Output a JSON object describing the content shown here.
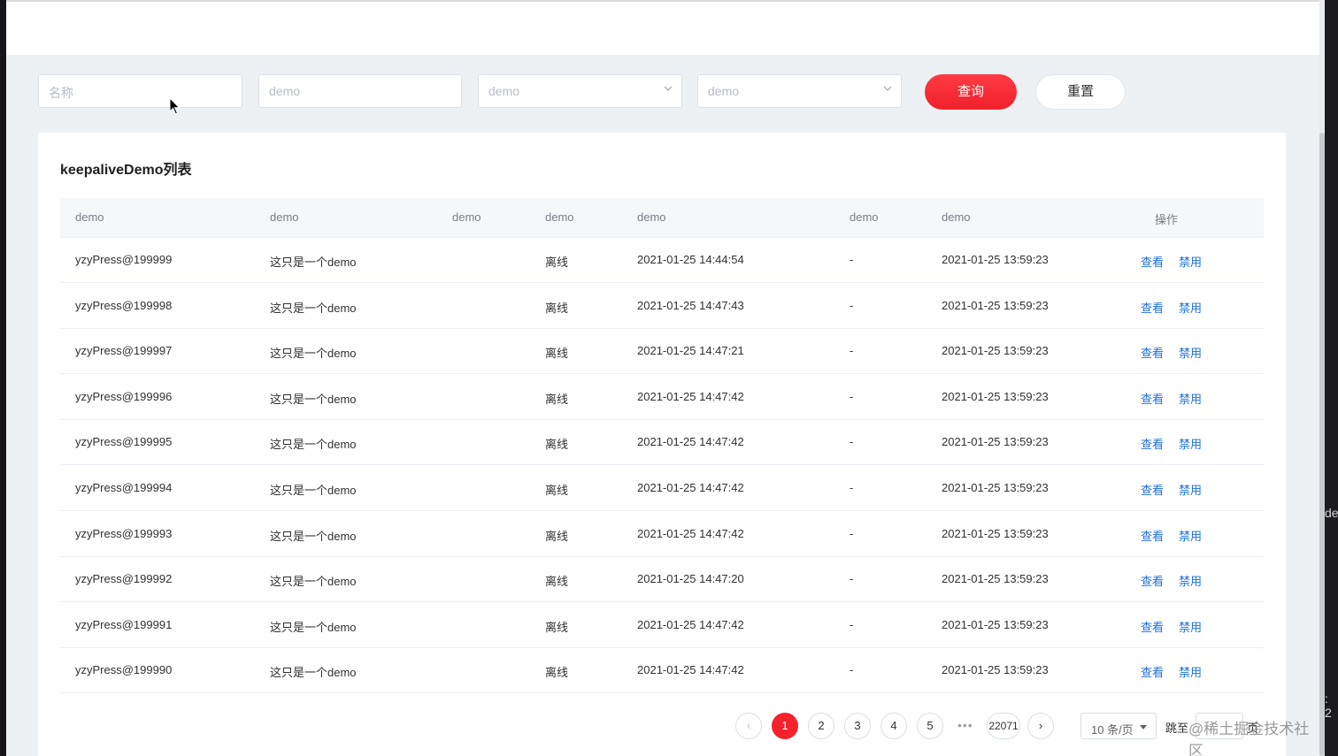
{
  "filters": {
    "name_placeholder": "名称",
    "field2_placeholder": "demo",
    "select1_placeholder": "demo",
    "select2_placeholder": "demo",
    "query_label": "查询",
    "reset_label": "重置"
  },
  "card": {
    "title": "keepaliveDemo列表"
  },
  "table": {
    "headers": [
      "demo",
      "demo",
      "demo",
      "demo",
      "demo",
      "demo",
      "demo",
      "操作"
    ],
    "rows": [
      {
        "id": "yzyPress@199999",
        "desc": "这只是一个demo",
        "status": "离线",
        "time1": "2021-01-25 14:44:54",
        "dash": "-",
        "time2": "2021-01-25 13:59:23"
      },
      {
        "id": "yzyPress@199998",
        "desc": "这只是一个demo",
        "status": "离线",
        "time1": "2021-01-25 14:47:43",
        "dash": "-",
        "time2": "2021-01-25 13:59:23"
      },
      {
        "id": "yzyPress@199997",
        "desc": "这只是一个demo",
        "status": "离线",
        "time1": "2021-01-25 14:47:21",
        "dash": "-",
        "time2": "2021-01-25 13:59:23"
      },
      {
        "id": "yzyPress@199996",
        "desc": "这只是一个demo",
        "status": "离线",
        "time1": "2021-01-25 14:47:42",
        "dash": "-",
        "time2": "2021-01-25 13:59:23"
      },
      {
        "id": "yzyPress@199995",
        "desc": "这只是一个demo",
        "status": "离线",
        "time1": "2021-01-25 14:47:42",
        "dash": "-",
        "time2": "2021-01-25 13:59:23"
      },
      {
        "id": "yzyPress@199994",
        "desc": "这只是一个demo",
        "status": "离线",
        "time1": "2021-01-25 14:47:42",
        "dash": "-",
        "time2": "2021-01-25 13:59:23"
      },
      {
        "id": "yzyPress@199993",
        "desc": "这只是一个demo",
        "status": "离线",
        "time1": "2021-01-25 14:47:42",
        "dash": "-",
        "time2": "2021-01-25 13:59:23"
      },
      {
        "id": "yzyPress@199992",
        "desc": "这只是一个demo",
        "status": "离线",
        "time1": "2021-01-25 14:47:20",
        "dash": "-",
        "time2": "2021-01-25 13:59:23"
      },
      {
        "id": "yzyPress@199991",
        "desc": "这只是一个demo",
        "status": "离线",
        "time1": "2021-01-25 14:47:42",
        "dash": "-",
        "time2": "2021-01-25 13:59:23"
      },
      {
        "id": "yzyPress@199990",
        "desc": "这只是一个demo",
        "status": "离线",
        "time1": "2021-01-25 14:47:42",
        "dash": "-",
        "time2": "2021-01-25 13:59:23"
      }
    ],
    "actions": {
      "view": "查看",
      "disable": "禁用"
    }
  },
  "pagination": {
    "prev": "‹",
    "pages": [
      "1",
      "2",
      "3",
      "4",
      "5"
    ],
    "more": "•••",
    "last": "22071",
    "next": "›",
    "page_size": "10 条/页",
    "goto_label": "跳至",
    "goto_suffix": "页"
  },
  "watermark": "@稀土掘金技术社区",
  "side_fragments": {
    "right_top": "de",
    "right_bottom": ": 2"
  },
  "colors": {
    "primary_red": "#f5222d",
    "link_blue": "#1e6fd9"
  }
}
